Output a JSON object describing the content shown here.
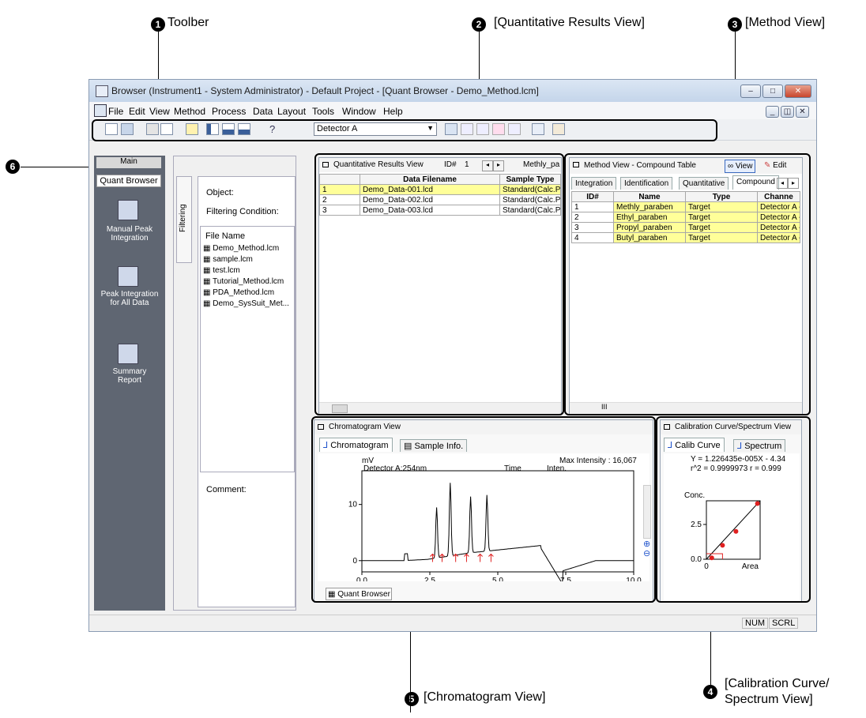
{
  "callouts": {
    "toolbar": {
      "num": "1",
      "label": "Toolber"
    },
    "quant": {
      "num": "2",
      "label": "[Quantitative Results View]"
    },
    "method": {
      "num": "3",
      "label": "[Method View]"
    },
    "calib": {
      "num": "4",
      "label": "[Calibration Curve/",
      "label2": "Spectrum View]"
    },
    "chrom": {
      "num": "5",
      "label": "[Chromatogram View]"
    },
    "six": {
      "num": "6"
    }
  },
  "window": {
    "title": "Browser (Instrument1 - System Administrator) - Default Project - [Quant Browser - Demo_Method.lcm]",
    "menu": [
      "File",
      "Edit",
      "View",
      "Method",
      "Process",
      "Data",
      "Layout",
      "Tools",
      "Window",
      "Help"
    ],
    "detector_select": "Detector A",
    "status": [
      "NUM",
      "SCRL"
    ]
  },
  "assistant": {
    "tab_main": "Main",
    "quant_browser": "Quant Browser",
    "items": [
      "Manual Peak Integration",
      "Peak Integration for All Data",
      "Summary Report"
    ]
  },
  "explorer": {
    "side_tab": "Filtering",
    "object_label": "Object:",
    "filter_label": "Filtering Condition:",
    "filename_header": "File Name",
    "files": [
      "Demo_Method.lcm",
      "sample.lcm",
      "test.lcm",
      "Tutorial_Method.lcm",
      "PDA_Method.lcm",
      "Demo_SysSuit_Met..."
    ],
    "comment_label": "Comment:"
  },
  "quant_view": {
    "title": "Quantitative Results View",
    "id_label": "ID#",
    "id_value": "1",
    "compound": "Methly_pa",
    "headers": [
      "",
      "Data Filename",
      "Sample Type"
    ],
    "rows": [
      [
        "1",
        "Demo_Data-001.lcd",
        "Standard(Calc.Po"
      ],
      [
        "2",
        "Demo_Data-002.lcd",
        "Standard(Calc.Po"
      ],
      [
        "3",
        "Demo_Data-003.lcd",
        "Standard(Calc.Po"
      ]
    ]
  },
  "method_view": {
    "title": "Method View - Compound Table",
    "view_btn": "View",
    "edit_btn": "Edit",
    "tabs": [
      "Integration",
      "Identification",
      "Quantitative",
      "Compound"
    ],
    "headers": [
      "ID#",
      "Name",
      "Type",
      "Channe"
    ],
    "rows": [
      [
        "1",
        "Methly_paraben",
        "Target",
        "Detector A -"
      ],
      [
        "2",
        "Ethyl_paraben",
        "Target",
        "Detector A -"
      ],
      [
        "3",
        "Propyl_paraben",
        "Target",
        "Detector A -"
      ],
      [
        "4",
        "Butyl_paraben",
        "Target",
        "Detector A -"
      ]
    ],
    "scroll_mark": "III"
  },
  "chrom_view": {
    "title": "Chromatogram View",
    "tabs": [
      "Chromatogram",
      "Sample Info."
    ],
    "unit": "mV",
    "max_intensity": "Max Intensity : 16,067",
    "detector": "Detector A:254nm",
    "time_label": "Time",
    "inten_label": "Inten.",
    "bottom_tab": "Quant Browser"
  },
  "calib_view": {
    "title": "Calibration Curve/Spectrum View",
    "tabs": [
      "Calib Curve",
      "Spectrum"
    ],
    "eq1": "Y = 1.226435e-005X - 4.34",
    "eq2": "r^2 = 0.9999973  r = 0.999",
    "ylabel": "Conc.",
    "xlabel": "Area"
  },
  "chart_data": [
    {
      "type": "line",
      "title": "Detector A:254nm",
      "ylabel": "mV",
      "xlim": [
        0.0,
        10.0
      ],
      "ylim": [
        -2,
        16
      ],
      "xticks": [
        "0.0",
        "2.5",
        "5.0",
        "7.5",
        "10.0"
      ],
      "yticks": [
        "0",
        "10"
      ],
      "peaks_x": [
        2.75,
        3.25,
        4.0,
        4.6
      ]
    },
    {
      "type": "scatter",
      "xlabel": "Area",
      "ylabel": "Conc.",
      "yticks": [
        "0.0",
        "2.5"
      ],
      "xticks": [
        "0"
      ],
      "points": [
        [
          0.1,
          0.1
        ],
        [
          0.3,
          1.0
        ],
        [
          0.55,
          2.0
        ],
        [
          0.95,
          4.0
        ]
      ]
    }
  ]
}
